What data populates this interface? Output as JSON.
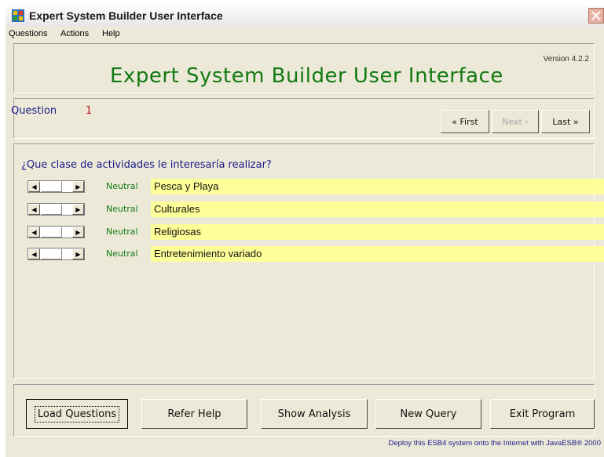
{
  "window": {
    "title": "Expert System Builder User Interface"
  },
  "menu": [
    "Questions",
    "Actions",
    "Help"
  ],
  "header": {
    "title": "Expert System Builder User Interface",
    "version": "Version 4.2.2"
  },
  "question": {
    "label": "Question",
    "number": "1",
    "nav": {
      "first": "« First",
      "next": "Next ›",
      "last": "Last »"
    },
    "prompt": "¿Que clase de actividades le interesaría realizar?",
    "options": [
      {
        "value": "Neutral",
        "label": "Pesca y Playa"
      },
      {
        "value": "Neutral",
        "label": "Culturales"
      },
      {
        "value": "Neutral",
        "label": "Religiosas"
      },
      {
        "value": "Neutral",
        "label": "Entretenimiento variado"
      }
    ]
  },
  "buttons": {
    "load": "Load Questions",
    "refer": "Refer Help",
    "analysis": "Show Analysis",
    "new_query": "New Query",
    "exit": "Exit Program"
  },
  "footer": "Deploy this ESB4 system onto the Internet with JavaESB® 2000",
  "colors": {
    "title_green": "#137a13",
    "question_blue": "#1c1c8c",
    "highlight_yellow": "#ffff99",
    "question_number_red": "#b21515"
  }
}
